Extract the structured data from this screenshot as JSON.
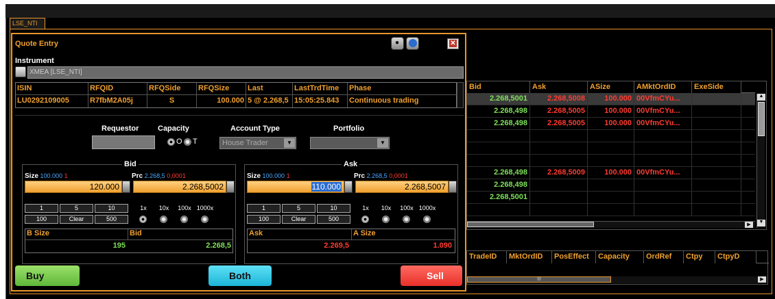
{
  "window": {
    "tab_label": "LSE_NTI"
  },
  "dialog": {
    "title": "Quote Entry",
    "instrument_label": "Instrument",
    "instrument_value": "XMEA [LSE_NTI]",
    "info_headers": [
      "ISIN",
      "RFQID",
      "RFQSide",
      "RFQSize",
      "Last",
      "LastTrdTime",
      "Phase"
    ],
    "info_values": [
      "LU0292109005",
      "R7fbM2A05j",
      "S",
      "100.000",
      "5 @ 2.268,5",
      "15:05:25.843",
      "Continuous trading"
    ],
    "requestor_label": "Requestor",
    "capacity_label": "Capacity",
    "capacity_options": [
      "O",
      "T"
    ],
    "account_type_label": "Account Type",
    "account_type_value": "House Trader",
    "portfolio_label": "Portfolio",
    "bid": {
      "title": "Bid",
      "size_label": "Size",
      "size_hint": "100.000",
      "size_hint2": "1",
      "prc_label": "Prc",
      "prc_hint": "2.268,5",
      "prc_hint2": "0,0001",
      "size_value": "120.000",
      "prc_value": "2.268,5002",
      "keys_row1": [
        "1",
        "5",
        "10"
      ],
      "keys_row2": [
        "100",
        "Clear",
        "500"
      ],
      "mult_labels": [
        "1x",
        "10x",
        "100x",
        "1000x"
      ],
      "table_headers": [
        "B Size",
        "Bid"
      ],
      "table_values": [
        "195",
        "2.268,5"
      ]
    },
    "ask": {
      "title": "Ask",
      "size_label": "Size",
      "size_hint": "100.000",
      "size_hint2": "1",
      "prc_label": "Prc",
      "prc_hint": "2.268,5",
      "prc_hint2": "0,0001",
      "size_value": "110.000",
      "prc_value": "2.268,5007",
      "keys_row1": [
        "1",
        "5",
        "10"
      ],
      "keys_row2": [
        "100",
        "Clear",
        "500"
      ],
      "mult_labels": [
        "1x",
        "10x",
        "100x",
        "1000x"
      ],
      "table_headers": [
        "Ask",
        "A Size"
      ],
      "table_values": [
        "2.269,5",
        "1.090"
      ]
    },
    "buttons": {
      "buy": "Buy",
      "both": "Both",
      "sell": "Sell"
    }
  },
  "quotes_grid": {
    "headers": [
      "Bid",
      "Ask",
      "ASize",
      "AMktOrdID",
      "ExeSide"
    ],
    "rows": [
      [
        "2.268,5001",
        "2.268,5008",
        "100.000",
        "00VfmCYu...",
        ""
      ],
      [
        "2.268,498",
        "2.268,5005",
        "100.000",
        "00VfmCYu...",
        ""
      ],
      [
        "2.268,498",
        "2.268,5005",
        "100.000",
        "00VfmCYu...",
        ""
      ],
      [
        "",
        "",
        "",
        "",
        ""
      ],
      [
        "",
        "",
        "",
        "",
        ""
      ],
      [
        "",
        "",
        "",
        "",
        ""
      ],
      [
        "2.268,498",
        "2.268,5009",
        "100.000",
        "00VfmCYu...",
        ""
      ],
      [
        "2.268,498",
        "",
        "",
        "",
        ""
      ],
      [
        "2.268,5001",
        "",
        "",
        "",
        ""
      ],
      [
        "",
        "",
        "",
        "",
        ""
      ]
    ]
  },
  "trades_grid": {
    "headers": [
      "TradeID",
      "MktOrdID",
      "PosEffect",
      "Capacity",
      "OrdRef",
      "Ctpy",
      "CtpyD"
    ],
    "scroll_label": "III"
  }
}
